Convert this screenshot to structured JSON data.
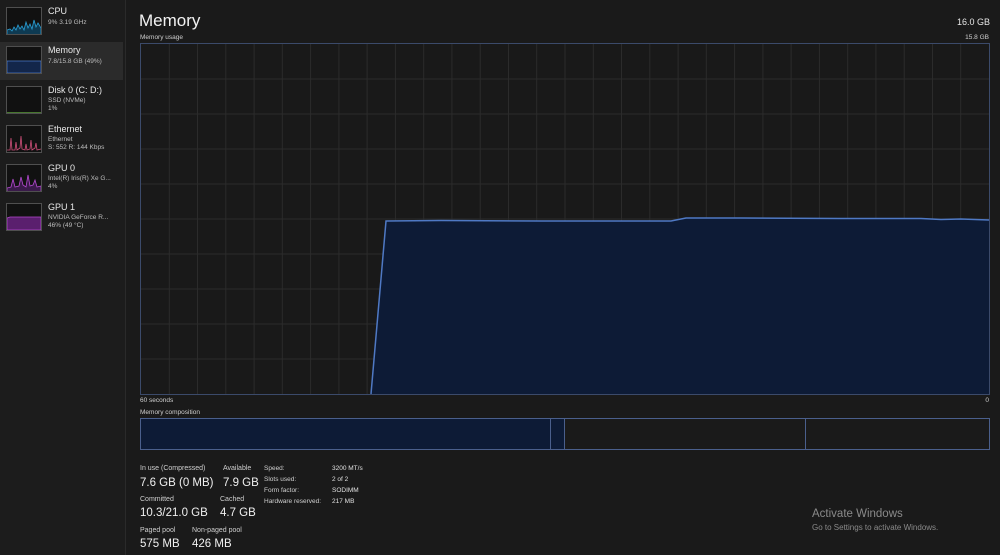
{
  "sidebar": {
    "items": [
      {
        "title": "CPU",
        "lines": [
          "9%  3.19 GHz"
        ],
        "color": "#2aa1d8"
      },
      {
        "title": "Memory",
        "lines": [
          "7.8/15.8 GB (49%)"
        ],
        "color": "#4a78c8"
      },
      {
        "title": "Disk 0 (C: D:)",
        "lines": [
          "SSD (NVMe)",
          "1%"
        ],
        "color": "#5a9a3a"
      },
      {
        "title": "Ethernet",
        "lines": [
          "Ethernet",
          "S: 552  R: 144 Kbps"
        ],
        "color": "#d0507a"
      },
      {
        "title": "GPU 0",
        "lines": [
          "Intel(R) Iris(R) Xe G...",
          "4%"
        ],
        "color": "#b44ad0"
      },
      {
        "title": "GPU 1",
        "lines": [
          "NVIDIA GeForce R...",
          "46% (49 °C)"
        ],
        "color": "#b44ad0"
      }
    ]
  },
  "header": {
    "title": "Memory",
    "total": "16.0 GB",
    "usage_label": "Memory usage",
    "usage_max": "15.8 GB"
  },
  "graph": {
    "x_left_label": "60 seconds",
    "x_right_label": "0",
    "line_color": "#4f79c4",
    "fill_color": "#0d1b36"
  },
  "composition": {
    "label": "Memory composition"
  },
  "stats": {
    "in_use_label": "In use (Compressed)",
    "in_use_value": "7.6 GB (0 MB)",
    "available_label": "Available",
    "available_value": "7.9 GB",
    "committed_label": "Committed",
    "committed_value": "10.3/21.0 GB",
    "cached_label": "Cached",
    "cached_value": "4.7 GB",
    "paged_label": "Paged pool",
    "paged_value": "575 MB",
    "nonpaged_label": "Non-paged pool",
    "nonpaged_value": "426 MB"
  },
  "hardware": [
    {
      "label": "Speed:",
      "value": "3200 MT/s"
    },
    {
      "label": "Slots used:",
      "value": "2 of 2"
    },
    {
      "label": "Form factor:",
      "value": "SODIMM"
    },
    {
      "label": "Hardware reserved:",
      "value": "217 MB"
    }
  ],
  "watermark": {
    "title": "Activate Windows",
    "subtitle": "Go to Settings to activate Windows."
  }
}
